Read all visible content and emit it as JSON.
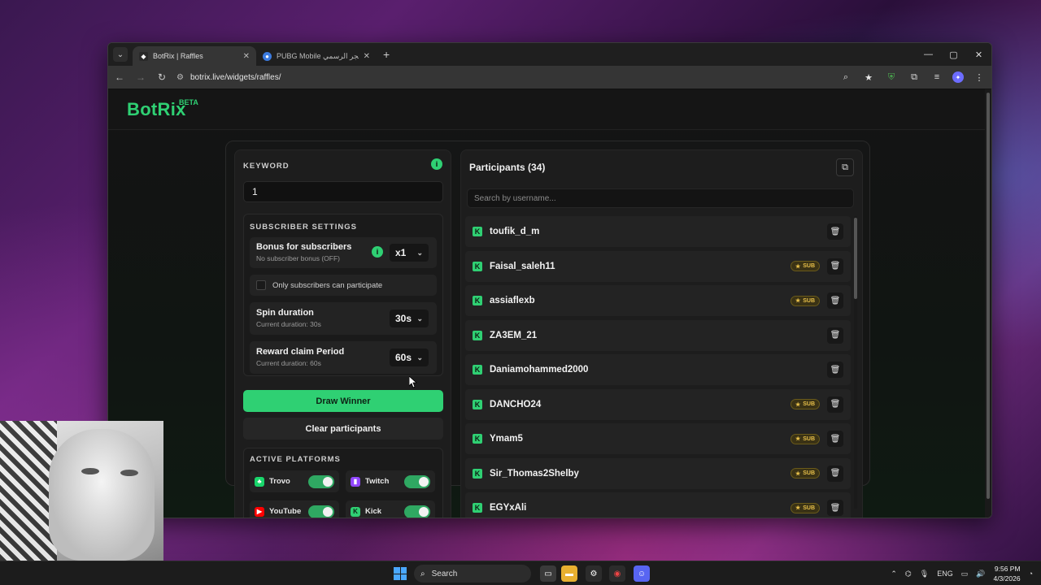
{
  "browser": {
    "tabs": [
      {
        "title": "BotRix | Raffles",
        "active": true
      },
      {
        "title": "PUBG Mobile لـ المتجر الرسمي |",
        "active": false
      }
    ],
    "url": "botrix.live/widgets/raffles/"
  },
  "app": {
    "logo": "BotRix",
    "logo_badge": "BETA",
    "keyword": {
      "label": "KEYWORD",
      "value": "1"
    },
    "subscriber_settings": {
      "title": "SUBSCRIBER SETTINGS",
      "bonus": {
        "title": "Bonus for subscribers",
        "subtitle": "No subscriber bonus (OFF)",
        "value": "x1"
      },
      "only_subs_label": "Only subscribers can participate",
      "spin": {
        "title": "Spin duration",
        "subtitle": "Current duration: 30s",
        "value": "30s"
      },
      "reward": {
        "title": "Reward claim Period",
        "subtitle": "Current duration: 60s",
        "value": "60s"
      }
    },
    "draw_winner_label": "Draw Winner",
    "clear_participants_label": "Clear participants",
    "active_platforms": {
      "title": "ACTIVE PLATFORMS",
      "items": [
        {
          "name": "Trovo",
          "enabled": true,
          "color": "#19d66b"
        },
        {
          "name": "Twitch",
          "enabled": true,
          "color": "#9146ff"
        },
        {
          "name": "YouTube",
          "enabled": true,
          "color": "#ff0000"
        },
        {
          "name": "Kick",
          "enabled": true,
          "color": "#53fc18"
        }
      ]
    },
    "participants": {
      "title": "Participants (34)",
      "search_placeholder": "Search by username...",
      "sub_badge": "SUB",
      "list": [
        {
          "name": "toufik_d_m",
          "sub": false
        },
        {
          "name": "Faisal_saleh11",
          "sub": true
        },
        {
          "name": "assiaflexb",
          "sub": true
        },
        {
          "name": "ZA3EM_21",
          "sub": false
        },
        {
          "name": "Daniamohammed2000",
          "sub": false
        },
        {
          "name": "DANCHO24",
          "sub": true
        },
        {
          "name": "Ymam5",
          "sub": true
        },
        {
          "name": "Sir_Thomas2Shelby",
          "sub": true
        },
        {
          "name": "EGYxAli",
          "sub": true
        }
      ]
    }
  },
  "taskbar": {
    "search_label": "Search",
    "language": "ENG",
    "time": "9:56 PM",
    "date": "4/3/2026"
  },
  "colors": {
    "accent": "#2fd073",
    "sub_badge": "#e8c04a"
  }
}
